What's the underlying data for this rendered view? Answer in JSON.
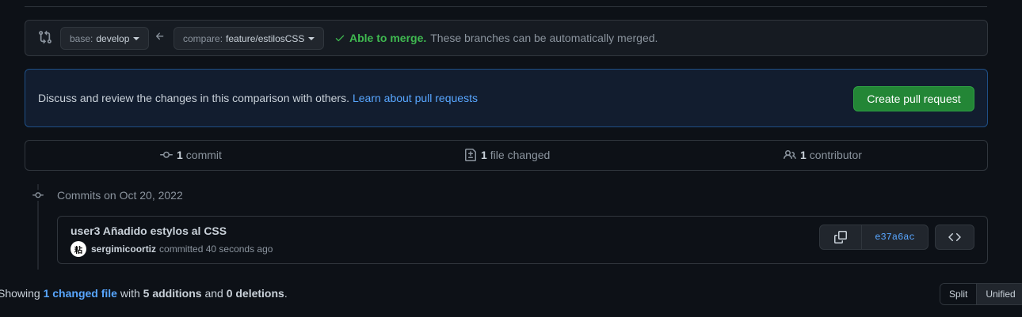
{
  "compare": {
    "base_prefix": "base:",
    "base_branch": "develop",
    "compare_prefix": "compare:",
    "compare_branch": "feature/estilosCSS",
    "merge_ok": "Able to merge.",
    "merge_desc": "These branches can be automatically merged."
  },
  "discuss": {
    "text": "Discuss and review the changes in this comparison with others.",
    "link": "Learn about pull requests",
    "button": "Create pull request"
  },
  "summary": {
    "commits_count": "1",
    "commits_label": "commit",
    "files_count": "1",
    "files_label": "file changed",
    "contributors_count": "1",
    "contributors_label": "contributor"
  },
  "timeline": {
    "date_label": "Commits on Oct 20, 2022"
  },
  "commit": {
    "title": "user3 Añadido estylos al CSS",
    "author": "sergimicoortiz",
    "action": "committed 40 seconds ago",
    "avatar_text": "粘",
    "sha": "e37a6ac"
  },
  "showing": {
    "prefix": "Showing",
    "files_link": "1 changed file",
    "with": "with",
    "additions": "5 additions",
    "and": "and",
    "deletions": "0 deletions",
    "suffix": "."
  },
  "view_toggle": {
    "split": "Split",
    "unified": "Unified"
  },
  "colors": {
    "background": "#0d1117",
    "accent_link": "#58a6ff",
    "success": "#3fb950",
    "button_green": "#238636"
  }
}
